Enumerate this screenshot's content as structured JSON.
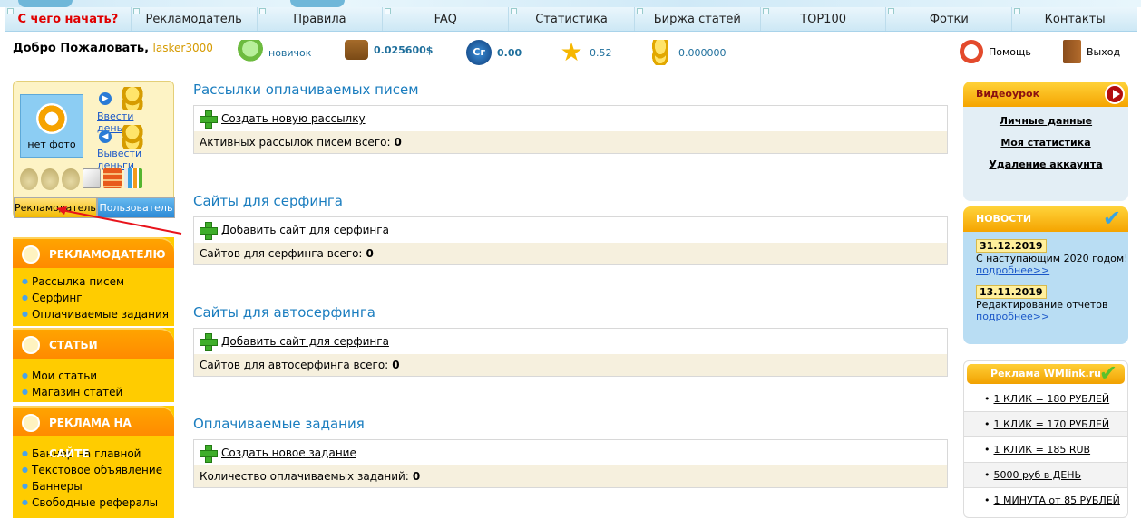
{
  "nav": [
    "С чего начать?",
    "Рекламодатель",
    "Правила",
    "FAQ",
    "Статистика",
    "Биржа статей",
    "TOP100",
    "Фотки",
    "Контакты"
  ],
  "welcome": {
    "text": "Добро Пожаловать,",
    "username": "lasker3000"
  },
  "stats": {
    "rank": "новичок",
    "balance": "0.025600$",
    "credits": "0.00",
    "credits_icon_text": "Cr",
    "rating": "0.52",
    "coins": "0.000000"
  },
  "actions": {
    "help": "Помощь",
    "exit": "Выход"
  },
  "profile": {
    "photo_label": "нет фото",
    "deposit": "Ввести деньги",
    "withdraw": "Вывести деньги",
    "tab_advertiser": "Рекламодатель",
    "tab_user": "Пользователь"
  },
  "menus": [
    {
      "title": "РЕКЛАМОДАТЕЛЮ",
      "items": [
        "Рассылка писем",
        "Серфинг",
        "Оплачиваемые задания"
      ]
    },
    {
      "title": "СТАТЬИ",
      "items": [
        "Мои статьи",
        "Магазин статей"
      ]
    },
    {
      "title": "РЕКЛАМА НА САЙТЕ",
      "items": [
        "Баннер на главной",
        "Текстовое объявление",
        "Баннеры",
        "Свободные рефералы"
      ]
    }
  ],
  "sections": [
    {
      "title": "Рассылки оплачиваемых писем",
      "add": "Создать новую рассылку",
      "summary": "Активных рассылок писем всего:",
      "count": "0"
    },
    {
      "title": "Сайты для серфинга",
      "add": "Добавить сайт для серфинга",
      "summary": "Сайтов для серфинга всего:",
      "count": "0"
    },
    {
      "title": "Сайты для автосерфинга",
      "add": "Добавить сайт для серфинга",
      "summary": "Сайтов для автосерфинга всего:",
      "count": "0"
    },
    {
      "title": "Оплачиваемые задания",
      "add": "Создать новое задание",
      "summary": "Количество оплачиваемых заданий:",
      "count": "0"
    }
  ],
  "video": {
    "title": "Видеоурок",
    "links": [
      "Личные данные",
      "Моя статистика",
      "Удаление аккаунта"
    ]
  },
  "news": {
    "title": "НОВОСТИ",
    "items": [
      {
        "date": "31.12.2019",
        "text": "С наступающим 2020 годом!",
        "more": "подробнее>>"
      },
      {
        "date": "13.11.2019",
        "text": "Редактирование отчетов",
        "more": "подробнее>>"
      }
    ]
  },
  "wmlink": {
    "title": "Реклама WMlink.ru",
    "items": [
      "1 КЛИК = 180 РУБЛЕЙ",
      "1 КЛИК = 170 РУБЛЕЙ",
      "1 КЛИК = 185 RUB",
      "5000 руб в ДЕНЬ",
      "1 МИНУТА от 85 РУБЛЕЙ"
    ]
  }
}
